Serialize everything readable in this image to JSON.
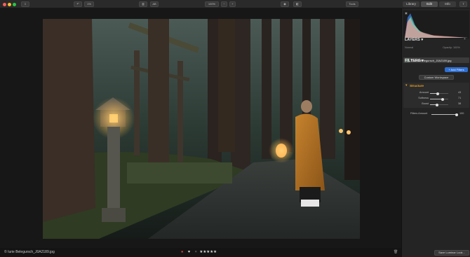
{
  "toolbar": {
    "tool_dropdown": "",
    "history_label": "",
    "history_count": "1%",
    "zoom_value": "100%",
    "zoom_minus": "−",
    "zoom_plus": "+",
    "tools_label": "Tools",
    "view_label": "",
    "split_label": "AB"
  },
  "modes": [
    {
      "label": "Library",
      "active": false
    },
    {
      "label": "Edit",
      "active": true
    },
    {
      "label": "Info",
      "active": false
    }
  ],
  "status": {
    "filename": "© Iurie Belegursch_J0A2189.jpg",
    "stars": "★★★★★",
    "heart": "♥",
    "reject": "×"
  },
  "panel": {
    "layers_title": "LAYERS",
    "layers_mode": "Normal",
    "layers_opacity": "Opacity: 100%",
    "layer_name": "© Iurie Belegursch_J0A2189.jpg",
    "filters_title": "FILTERS",
    "add_filters": "+ Add Filters",
    "workspace": "Custom Workspace",
    "structure_title": "Structure",
    "sliders": [
      {
        "label": "Amount",
        "value": 43
      },
      {
        "label": "Softness",
        "value": 71
      },
      {
        "label": "Boost",
        "value": 38
      }
    ],
    "filters_amount_label": "Filters Amount",
    "filters_amount_value": 100,
    "save_looks": "Save Luminar Look..."
  },
  "colors": {
    "accent": "#2f6fd0",
    "section_accent": "#e8a028",
    "panel_bg": "#242424",
    "toolbar_bg": "#2a2a2a"
  },
  "icons": [
    "traffic-light-close",
    "traffic-light-minimize",
    "traffic-light-zoom",
    "eye-icon",
    "compare-icon",
    "histogram-icon",
    "trash-icon",
    "share-icon"
  ]
}
